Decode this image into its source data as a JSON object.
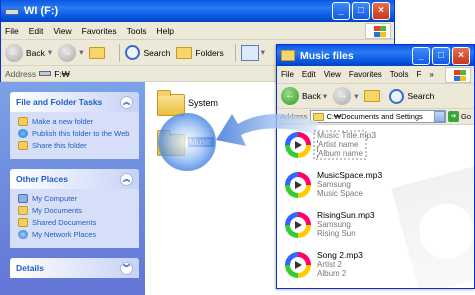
{
  "back_window": {
    "title": "WI (F:)",
    "menu": [
      "File",
      "Edit",
      "View",
      "Favorites",
      "Tools",
      "Help"
    ],
    "toolbar": {
      "back": "Back",
      "search": "Search",
      "folders": "Folders"
    },
    "address": {
      "label": "Address",
      "value": "F:₩"
    },
    "panels": {
      "tasks": {
        "title": "File and Folder Tasks",
        "items": [
          "Make a new folder",
          "Publish this folder to the Web",
          "Share this folder"
        ]
      },
      "places": {
        "title": "Other Places",
        "items": [
          "My Computer",
          "My Documents",
          "Shared Documents",
          "My Network Places"
        ]
      },
      "details": {
        "title": "Details"
      }
    },
    "folders": [
      "System",
      "Music"
    ]
  },
  "front_window": {
    "title": "Music files",
    "menu": [
      "File",
      "Edit",
      "View",
      "Favorites",
      "Tools",
      "F"
    ],
    "toolbar": {
      "back": "Back",
      "search": "Search"
    },
    "address": {
      "label": "Address",
      "value": "C:₩Documents and Settings",
      "go": "Go"
    },
    "files": [
      {
        "name": "Music Title.mp3",
        "artist": "Artist name",
        "album": "Album name"
      },
      {
        "name": "MusicSpace.mp3",
        "artist": "Samsung",
        "album": "Music Space"
      },
      {
        "name": "RisingSun.mp3",
        "artist": "Samsung",
        "album": "Rising Sun"
      },
      {
        "name": "Song 2.mp3",
        "artist": "Artist 2",
        "album": "Album 2"
      }
    ]
  },
  "colors": {
    "xp_blue": "#0a58e3",
    "task_link": "#215dc6",
    "drag_arrow": "#5b8fe0"
  }
}
